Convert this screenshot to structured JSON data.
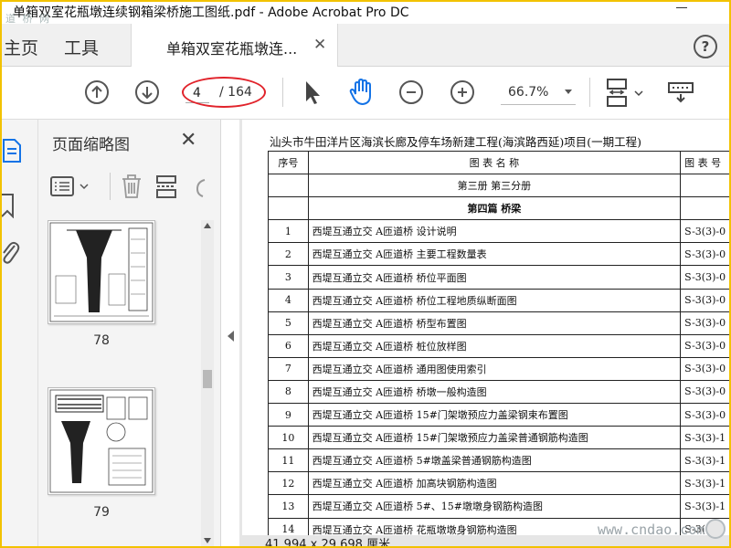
{
  "window": {
    "title": "单箱双室花瓶墩连续钢箱梁桥施工图纸.pdf - Adobe Acrobat Pro DC",
    "watermark_top": "道 桥 网"
  },
  "tabs": {
    "home": "主页",
    "tools": "工具",
    "document": "单箱双室花瓶墩连...",
    "help_glyph": "?"
  },
  "toolbar": {
    "current_page": "4",
    "total_pages": "/ 164",
    "zoom": "66.7%",
    "icons": [
      "prev-page-icon",
      "next-page-icon",
      "select-cursor-icon",
      "hand-tool-icon",
      "zoom-out-icon",
      "zoom-in-icon",
      "page-view-icon",
      "keyboard-icon"
    ],
    "accent_red": "#e1232b",
    "hand_blue": "#1473e6"
  },
  "thumbnails": {
    "title": "页面缩略图",
    "close_glyph": "✕",
    "pages": [
      {
        "number": "78"
      },
      {
        "number": "79"
      }
    ]
  },
  "document": {
    "heading": "汕头市牛田洋片区海滨长廊及停车场新建工程(海滨路西延)项目(一期工程)",
    "columns": [
      "序号",
      "图 表 名 称",
      "图 表 号"
    ],
    "section_rows": [
      "第三册 第三分册",
      "第四篇 桥梁"
    ],
    "rows": [
      {
        "no": "1",
        "name": "西堤互通立交 A匝道桥 设计说明",
        "code": "S-3(3)-0"
      },
      {
        "no": "2",
        "name": "西堤互通立交 A匝道桥 主要工程数量表",
        "code": "S-3(3)-0"
      },
      {
        "no": "3",
        "name": "西堤互通立交 A匝道桥 桥位平面图",
        "code": "S-3(3)-0"
      },
      {
        "no": "4",
        "name": "西堤互通立交 A匝道桥 桥位工程地质纵断面图",
        "code": "S-3(3)-0"
      },
      {
        "no": "5",
        "name": "西堤互通立交 A匝道桥 桥型布置图",
        "code": "S-3(3)-0"
      },
      {
        "no": "6",
        "name": "西堤互通立交 A匝道桥 桩位放样图",
        "code": "S-3(3)-0"
      },
      {
        "no": "7",
        "name": "西堤互通立交 A匝道桥 通用图使用索引",
        "code": "S-3(3)-0"
      },
      {
        "no": "8",
        "name": "西堤互通立交 A匝道桥 桥墩一般构造图",
        "code": "S-3(3)-0"
      },
      {
        "no": "9",
        "name": "西堤互通立交 A匝道桥 15#门架墩预应力盖梁钢束布置图",
        "code": "S-3(3)-0"
      },
      {
        "no": "10",
        "name": "西堤互通立交 A匝道桥 15#门架墩预应力盖梁普通钢筋构造图",
        "code": "S-3(3)-1"
      },
      {
        "no": "11",
        "name": "西堤互通立交 A匝道桥 5#墩盖梁普通钢筋构造图",
        "code": "S-3(3)-1"
      },
      {
        "no": "12",
        "name": "西堤互通立交 A匝道桥 加高块钢筋构造图",
        "code": "S-3(3)-1"
      },
      {
        "no": "13",
        "name": "西堤互通立交 A匝道桥 5#、15#墩墩身钢筋构造图",
        "code": "S-3(3)-1"
      },
      {
        "no": "14",
        "name": "西堤互通立交 A匝道桥 花瓶墩墩身钢筋构造图",
        "code": "S-3(3)-1"
      }
    ]
  },
  "status": {
    "page_size": "41.994 x 29.698 厘米"
  },
  "watermark_bottom": "www.cndao.com"
}
